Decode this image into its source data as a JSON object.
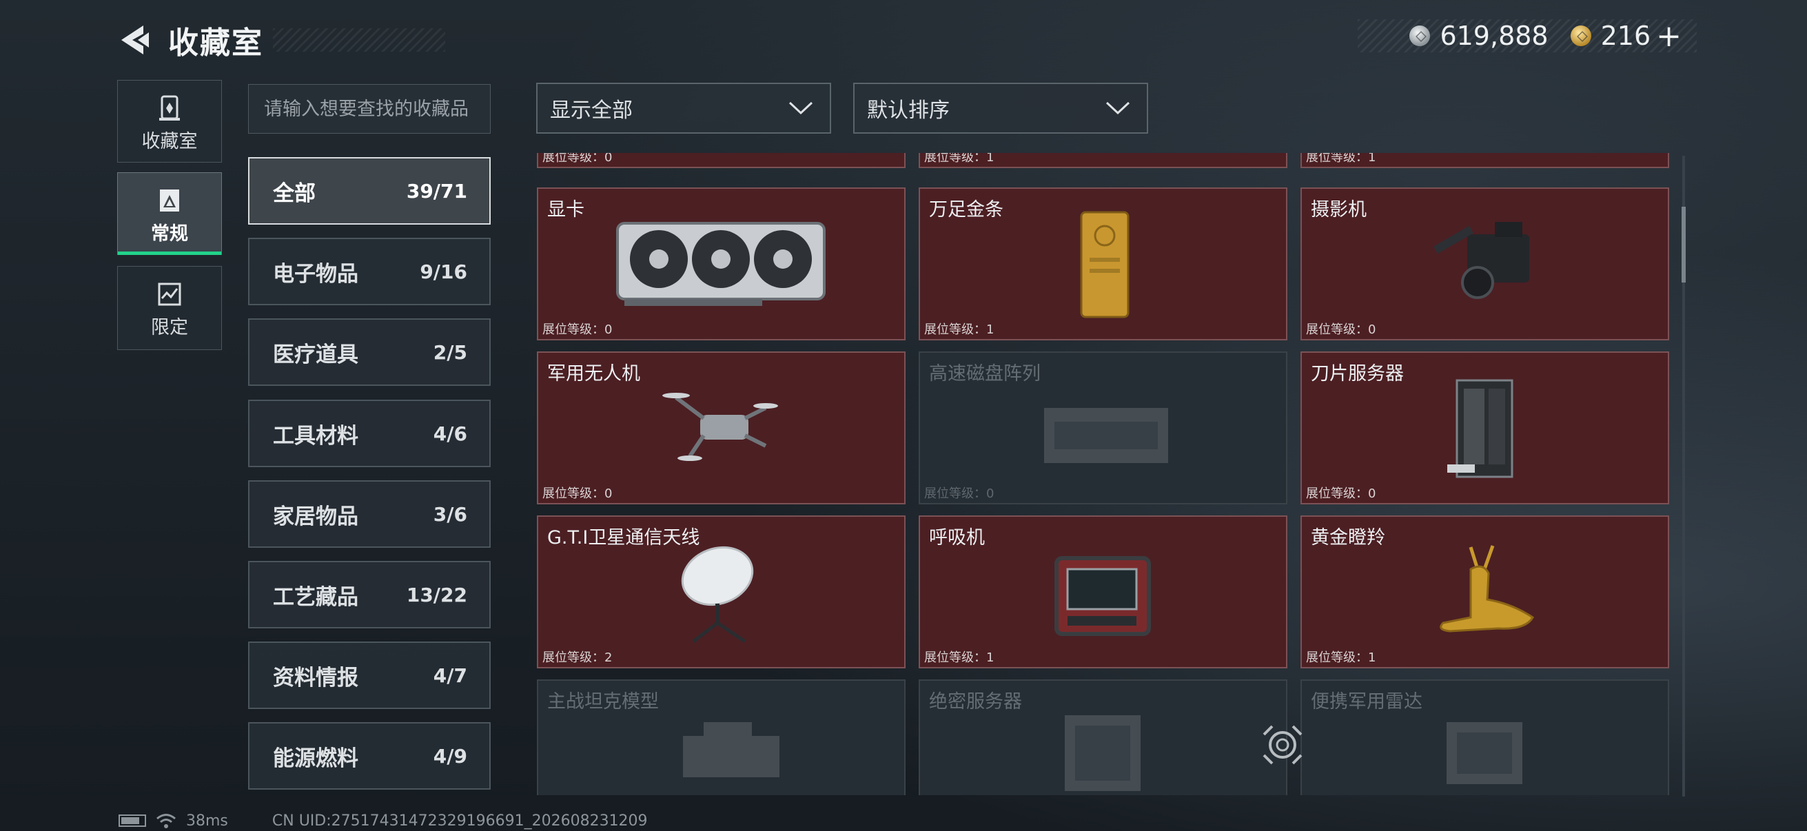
{
  "header": {
    "title": "收藏室",
    "currency": [
      {
        "icon": "silver-coin-icon",
        "value": "619,888"
      },
      {
        "icon": "gold-coin-icon",
        "value": "216"
      }
    ],
    "add_label": "+"
  },
  "tabs": [
    {
      "label": "收藏室",
      "icon": "collection-room-icon",
      "active": false
    },
    {
      "label": "常规",
      "icon": "regular-icon",
      "active": true
    },
    {
      "label": "限定",
      "icon": "limited-icon",
      "active": false
    }
  ],
  "search": {
    "placeholder": "请输入想要查找的收藏品"
  },
  "categories": [
    {
      "name": "全部",
      "count": "39/71",
      "active": true
    },
    {
      "name": "电子物品",
      "count": "9/16"
    },
    {
      "name": "医疗道具",
      "count": "2/5"
    },
    {
      "name": "工具材料",
      "count": "4/6"
    },
    {
      "name": "家居物品",
      "count": "3/6"
    },
    {
      "name": "工艺藏品",
      "count": "13/22"
    },
    {
      "name": "资料情报",
      "count": "4/7"
    },
    {
      "name": "能源燃料",
      "count": "4/9"
    }
  ],
  "filters": {
    "display": "显示全部",
    "sort": "默认排序"
  },
  "level_prefix": "展位等级：",
  "partial_row": [
    {
      "level": "0"
    },
    {
      "level": "1"
    },
    {
      "level": "1"
    }
  ],
  "items": [
    {
      "name": "显卡",
      "level": "0",
      "collected": true,
      "icon": "graphics-card-icon"
    },
    {
      "name": "万足金条",
      "level": "1",
      "collected": true,
      "icon": "gold-bar-icon"
    },
    {
      "name": "摄影机",
      "level": "0",
      "collected": true,
      "icon": "video-camera-icon"
    },
    {
      "name": "军用无人机",
      "level": "0",
      "collected": true,
      "icon": "drone-icon"
    },
    {
      "name": "高速磁盘阵列",
      "level": "0",
      "collected": false,
      "icon": "disk-array-icon"
    },
    {
      "name": "刀片服务器",
      "level": "0",
      "collected": true,
      "icon": "blade-server-icon"
    },
    {
      "name": "G.T.I卫星通信天线",
      "level": "2",
      "collected": true,
      "icon": "satellite-antenna-icon"
    },
    {
      "name": "呼吸机",
      "level": "1",
      "collected": true,
      "icon": "ventilator-icon"
    },
    {
      "name": "黄金瞪羚",
      "level": "1",
      "collected": true,
      "icon": "golden-gazelle-icon"
    },
    {
      "name": "主战坦克模型",
      "collected": false,
      "icon": "tank-model-icon"
    },
    {
      "name": "绝密服务器",
      "collected": false,
      "icon": "secret-server-icon"
    },
    {
      "name": "便携军用雷达",
      "collected": false,
      "icon": "portable-radar-icon"
    }
  ],
  "footer": {
    "ping": "38ms",
    "uid": "CN UID:27517431472329196691_202608231209"
  },
  "colors": {
    "card_collected": "#4c1f23",
    "card_locked": "#262e35",
    "accent_green": "#22d28a"
  }
}
